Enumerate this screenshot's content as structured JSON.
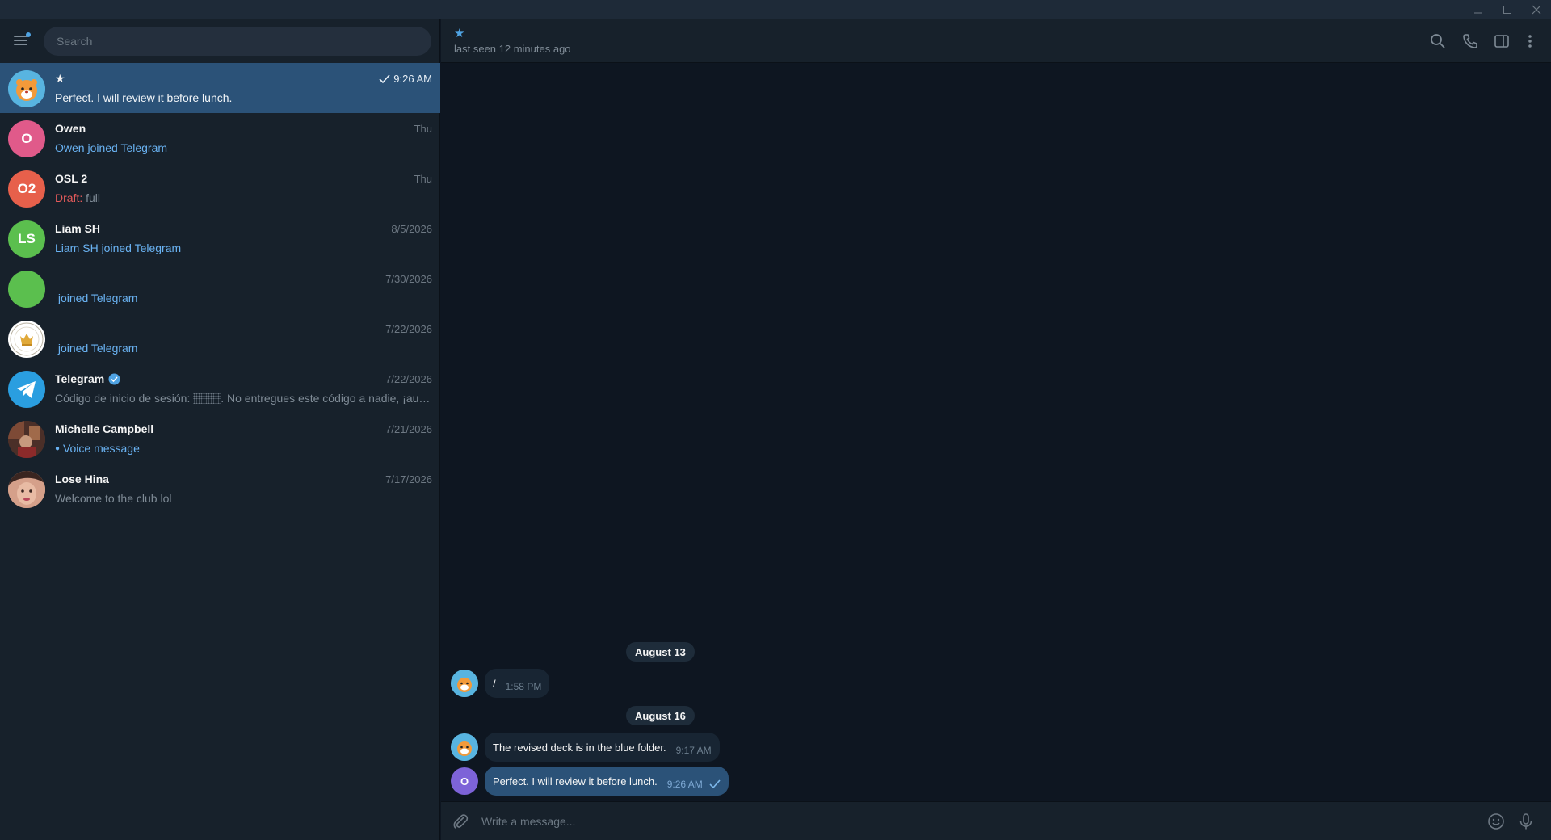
{
  "window": {
    "controls": [
      "minimize",
      "maximize",
      "close"
    ]
  },
  "sidebar": {
    "search_placeholder": "Search",
    "chats": [
      {
        "name": "★",
        "time": "9:26 AM",
        "read_check": true,
        "preview": "Perfect. I will review it before lunch.",
        "active": true,
        "avatar": {
          "type": "image",
          "icon": "tiger-cartoon-avatar"
        }
      },
      {
        "name": "Owen",
        "time": "Thu",
        "preview": "Owen joined Telegram",
        "preview_style": "link",
        "avatar": {
          "type": "initials",
          "text": "O",
          "color": "#e05a8a"
        }
      },
      {
        "name": "OSL 2",
        "time": "Thu",
        "draft_label": "Draft:",
        "preview": "full",
        "avatar": {
          "type": "initials",
          "text": "O2",
          "color": "#e7604b"
        }
      },
      {
        "name": "Liam SH",
        "time": "8/5/2026",
        "preview": "Liam SH joined Telegram",
        "preview_style": "link",
        "avatar": {
          "type": "initials",
          "text": "LS",
          "color": "#5bbf4e"
        }
      },
      {
        "name": "",
        "time": "7/30/2026",
        "preview": " joined Telegram",
        "preview_style": "link",
        "avatar": {
          "type": "initials",
          "text": "",
          "color": "#5bbf4e"
        }
      },
      {
        "name": "",
        "time": "7/22/2026",
        "preview": " joined Telegram",
        "preview_style": "link",
        "avatar": {
          "type": "image",
          "icon": "crest-logo-avatar"
        }
      },
      {
        "name": "Telegram",
        "verified": true,
        "time": "7/22/2026",
        "preview_prefix": "Código de inicio de sesión: ",
        "preview": ". No entregues este código a nadie, ¡aunque ...",
        "avatar": {
          "type": "image",
          "icon": "telegram-logo-avatar",
          "color": "#2a9ee0"
        }
      },
      {
        "name": "Michelle Campbell",
        "time": "7/21/2026",
        "preview": "Voice message",
        "preview_style": "link",
        "voice_dot": true,
        "avatar": {
          "type": "image",
          "icon": "photo-avatar-room"
        }
      },
      {
        "name": "Lose Hina",
        "time": "7/17/2026",
        "preview": "Welcome to the club lol",
        "avatar": {
          "type": "image",
          "icon": "photo-avatar-face"
        }
      }
    ]
  },
  "header": {
    "title": "★",
    "status": "last seen 12 minutes ago",
    "icons": [
      "search-icon",
      "phone-icon",
      "sidebar-toggle-icon",
      "more-icon"
    ]
  },
  "messages": {
    "groups": [
      {
        "date": "August 13",
        "items": [
          {
            "text": "/",
            "time": "1:58 PM",
            "outgoing": false
          }
        ]
      },
      {
        "date": "August 16",
        "items": [
          {
            "text": "The revised deck is in the blue folder.",
            "time": "9:17 AM",
            "outgoing": false
          },
          {
            "text": "Perfect. I will review it before lunch.",
            "time": "9:26 AM",
            "outgoing": true,
            "read": true
          }
        ]
      }
    ]
  },
  "compose": {
    "placeholder": "Write a message..."
  },
  "colors": {
    "accent": "#4fa3e3",
    "active_chat": "#2b5278",
    "sidebar_bg": "#17212b",
    "chat_bg": "#0e1621"
  }
}
